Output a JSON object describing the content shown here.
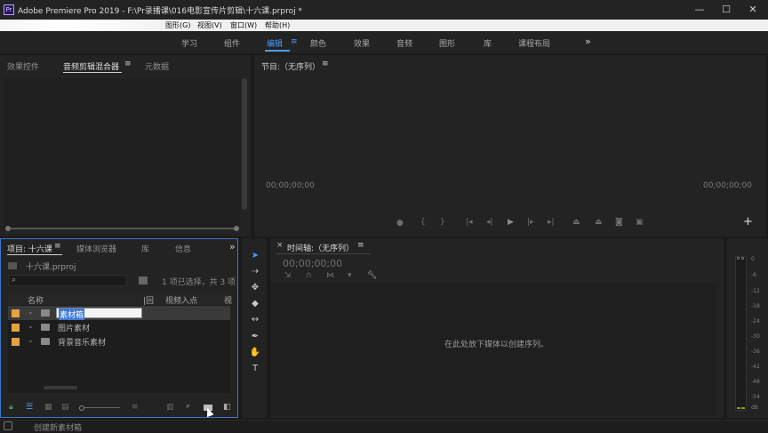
{
  "app": {
    "logo_text": "Pr",
    "window_title": "Adobe Premiere Pro 2019 - F:\\Pr录播课\\016电影宣传片剪辑\\十六课.prproj *",
    "minimize": "—",
    "maximize": "☐",
    "close": "✕"
  },
  "menubar": {
    "items": [
      "图形(G)",
      "视图(V)",
      "窗口(W)",
      "帮助(H)"
    ]
  },
  "workspace": {
    "tabs": [
      "学习",
      "组件",
      "编辑",
      "颜色",
      "效果",
      "音频",
      "图形",
      "库",
      "课程布局"
    ],
    "active": "编辑",
    "menu_glyph": "≡",
    "overflow": "»"
  },
  "source_panel": {
    "tabs": [
      "效果控件",
      "音频剪辑混合器",
      "元数据"
    ],
    "active_tab": "音频剪辑混合器",
    "menu_glyph": "≡"
  },
  "program_monitor": {
    "title": "节目:（无序列）",
    "menu_glyph": "≡",
    "timecode_left": "00;00;00;00",
    "timecode_right": "00;00;00;00",
    "add_glyph": "+"
  },
  "project_panel": {
    "tabs": [
      "项目: 十六课",
      "媒体浏览器",
      "库",
      "信息"
    ],
    "menu_glyph": "≡",
    "overflow": "»",
    "file_name": "十六课.prproj",
    "selection_status": "1 项已选择，共 3 项",
    "columns": [
      "名称",
      "帧速率",
      "视频入点"
    ],
    "column_rate_fragment": "|回",
    "column_extra_fragment": "视",
    "rows": [
      {
        "label": "素材箱",
        "editing": true
      },
      {
        "label": "图片素材",
        "editing": false
      },
      {
        "label": "背景音乐素材",
        "editing": false
      }
    ]
  },
  "timeline": {
    "close_glyph": "×",
    "title": "时间轴:（无序列）",
    "menu_glyph": "≡",
    "timecode": "00;00;00;00",
    "empty_message": "在此处放下媒体以创建序列。"
  },
  "audio_meter": {
    "labels": [
      "0",
      "-6",
      "-12",
      "-18",
      "-24",
      "-30",
      "-36",
      "-42",
      "-48",
      "-54",
      "dB"
    ]
  },
  "statusbar": {
    "text": "创建新素材箱"
  },
  "colors": {
    "accent": "#4f9bff",
    "label_orange": "#e4a240",
    "panel_bg": "#232323",
    "frame_bg": "#1a1a1a"
  }
}
